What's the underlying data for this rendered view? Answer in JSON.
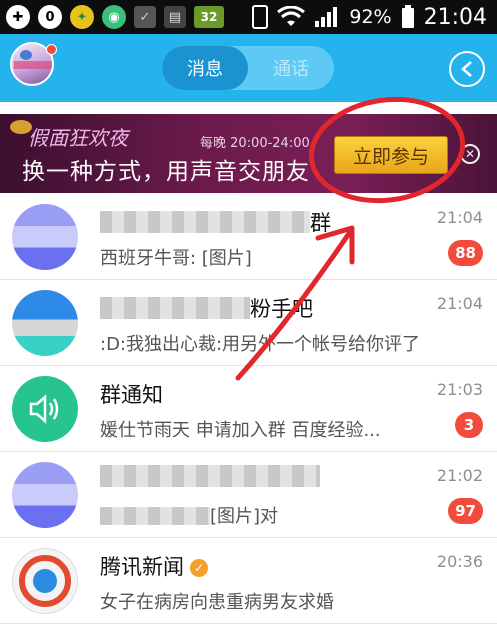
{
  "status_bar": {
    "battery": "92%",
    "time": "21:04",
    "notification_icons": [
      "plus-icon",
      "zero-icon",
      "green-app-icon",
      "chat-bubble-icon",
      "checkbox-icon",
      "clipboard-icon",
      "battery-indicator-icon"
    ],
    "badge_text": "32"
  },
  "header": {
    "tabs": [
      {
        "label": "消息",
        "active": true
      },
      {
        "label": "通话",
        "active": false
      }
    ],
    "back_icon": "chevron-left-icon"
  },
  "banner": {
    "tag": "假面狂欢夜",
    "time_text": "每晚 20:00-24:00",
    "headline": "换一种方式，用声音交朋友",
    "join_label": "立即参与",
    "close_icon": "close-icon"
  },
  "conversations": [
    {
      "name": "",
      "message": "西班牙牛哥: [图片]",
      "time": "21:04",
      "badge": "88",
      "name_suffix": "群"
    },
    {
      "name": "",
      "message": ":D:我独出心裁:用另外一个帐号给你评了",
      "time": "21:04",
      "badge": "",
      "name_suffix": "粉手吧"
    },
    {
      "name": "群通知",
      "message": "媛仕节雨天 申请加入群 百度经验...",
      "time": "21:03",
      "badge": "3",
      "name_suffix": ""
    },
    {
      "name": "",
      "message": "[图片]对",
      "time": "21:02",
      "badge": "97",
      "name_suffix": ""
    },
    {
      "name": "腾讯新闻",
      "message": "女子在病房向患重病男友求婚",
      "time": "20:36",
      "badge": "",
      "name_suffix": ""
    }
  ],
  "colors": {
    "header_blue": "#25b3ee",
    "badge_red": "#f24a3d",
    "notice_green": "#27c391",
    "join_gold": "#f3c131"
  }
}
